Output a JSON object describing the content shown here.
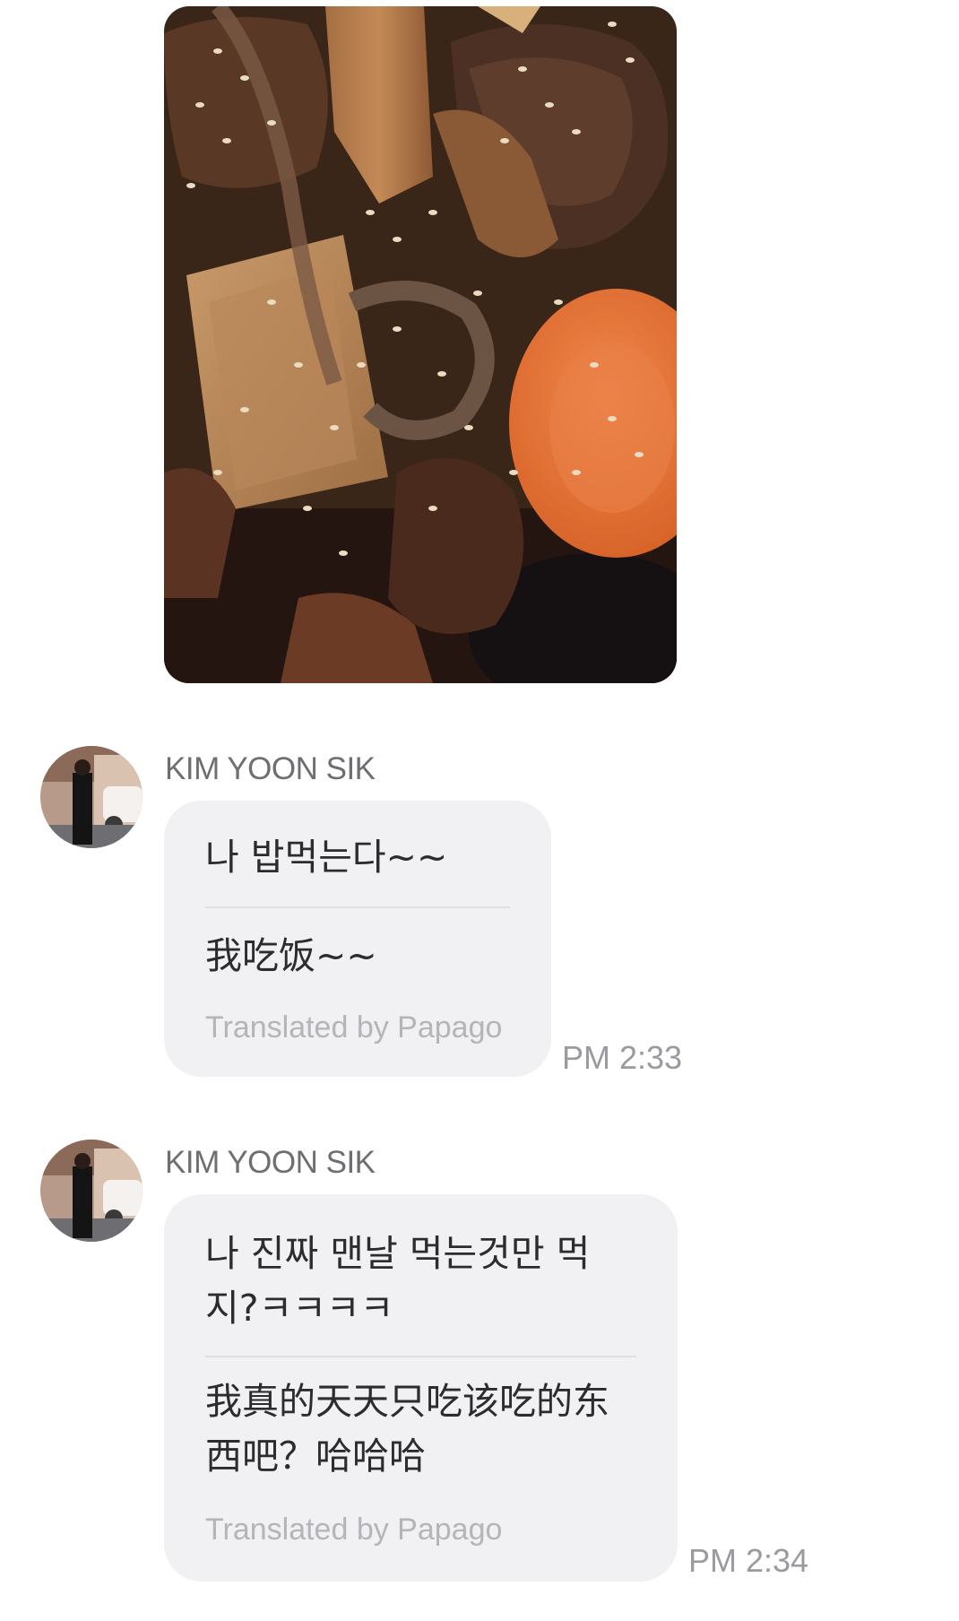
{
  "photo_message": {
    "image": "braised-vegetables-with-sesame-photo"
  },
  "messages": [
    {
      "sender": "KIM YOON SIK",
      "original": "나 밥먹는다~~",
      "translation": "我吃饭~~",
      "translation_credit": "Translated by Papago",
      "time": "PM 2:33"
    },
    {
      "sender": "KIM YOON SIK",
      "original": "나 진짜 맨날 먹는것만 먹지?ㅋㅋㅋㅋ",
      "translation": "我真的天天只吃该吃的东西吧？哈哈哈",
      "translation_credit": "Translated by Papago",
      "time": "PM 2:34"
    }
  ],
  "colors": {
    "bubble_background": "#f1f1f4",
    "sender_text": "#6f6f73",
    "timestamp_text": "#9a9aa0",
    "credit_text": "#b4b4b9"
  }
}
